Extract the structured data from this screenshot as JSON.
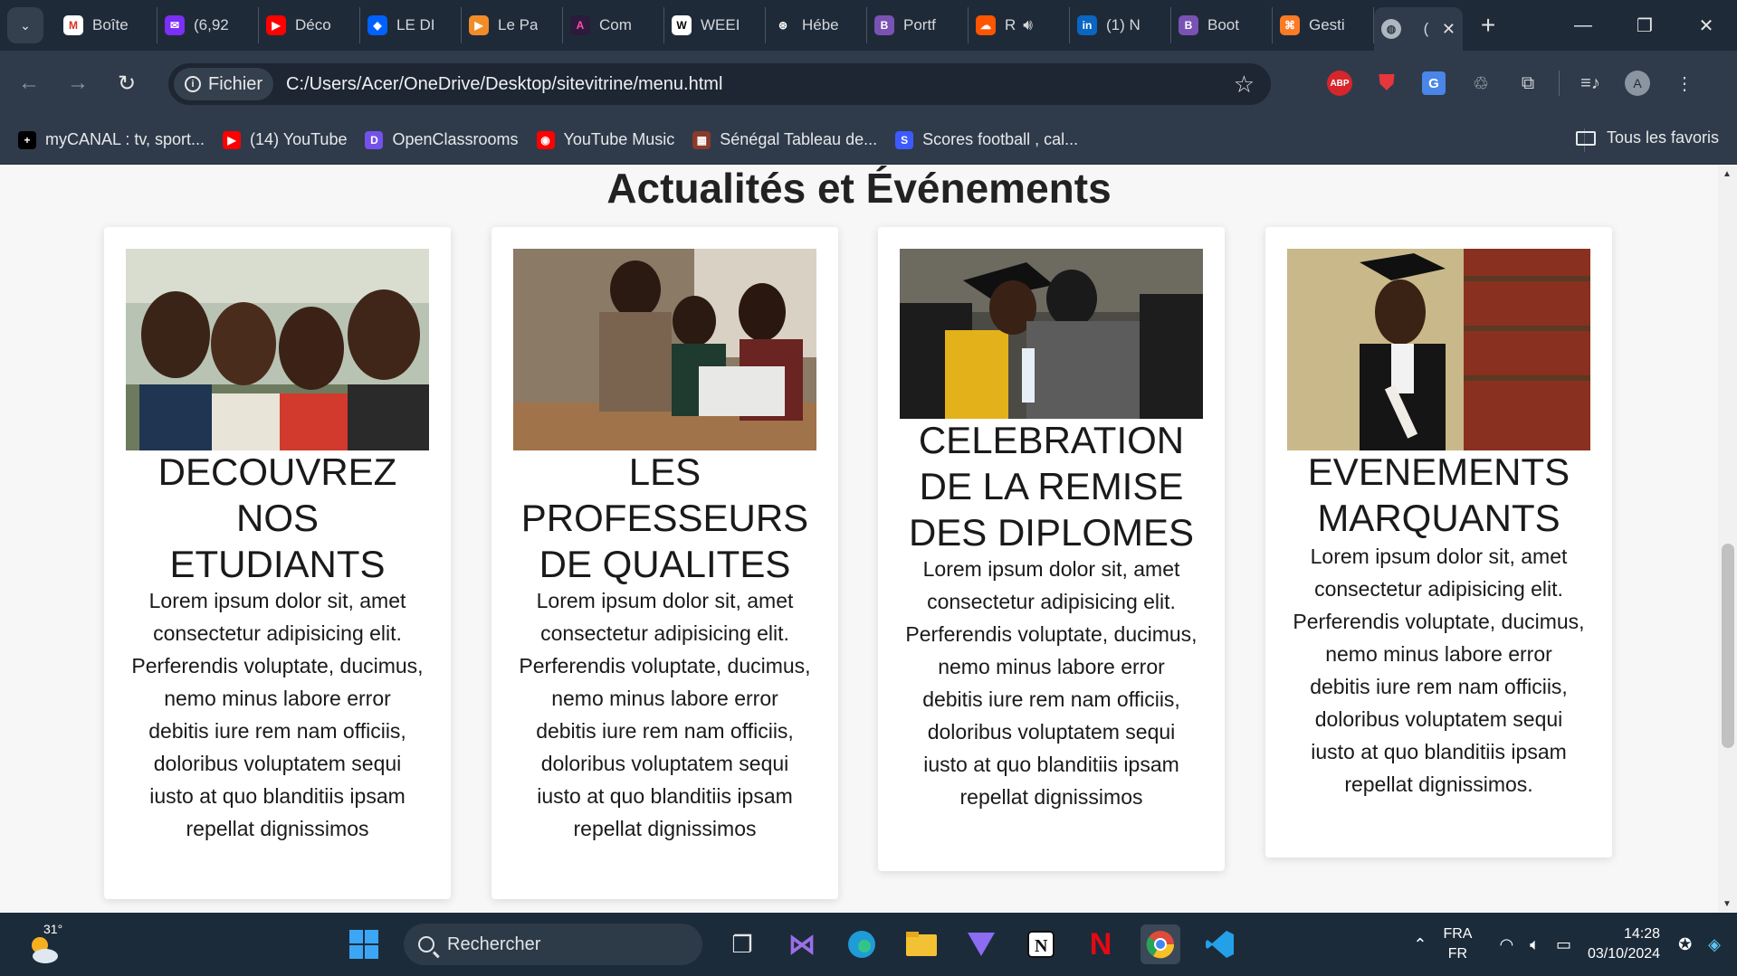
{
  "tabs": [
    {
      "label": "Boîte",
      "fav_color": "#ffffff",
      "fav_text": "M",
      "fav_text_color": "#d93025"
    },
    {
      "label": "(6,92",
      "fav_color": "#7b2ff7",
      "fav_text": "✉",
      "fav_text_color": "#ffffff"
    },
    {
      "label": "Déco",
      "fav_color": "#ff0000",
      "fav_text": "▶",
      "fav_text_color": "#ffffff"
    },
    {
      "label": "LE DI",
      "fav_color": "#0061fe",
      "fav_text": "◆",
      "fav_text_color": "#ffffff"
    },
    {
      "label": "Le Pa",
      "fav_color": "#f28c28",
      "fav_text": "▶",
      "fav_text_color": "#ffffff"
    },
    {
      "label": "Com",
      "fav_color": "#2b1b3d",
      "fav_text": "A",
      "fav_text_color": "#ff4fa3"
    },
    {
      "label": "WEEI",
      "fav_color": "#ffffff",
      "fav_text": "W",
      "fav_text_color": "#000000"
    },
    {
      "label": "Hébe",
      "fav_color": "#1f2a38",
      "fav_text": "⊛",
      "fav_text_color": "#ffffff"
    },
    {
      "label": "Portf",
      "fav_color": "#7952b3",
      "fav_text": "B",
      "fav_text_color": "#ffffff"
    },
    {
      "label": "R",
      "fav_color": "#ff5500",
      "fav_text": "☁",
      "fav_text_color": "#ffffff"
    },
    {
      "label": "(1) N",
      "fav_color": "#0a66c2",
      "fav_text": "in",
      "fav_text_color": "#ffffff"
    },
    {
      "label": "Boot",
      "fav_color": "#7952b3",
      "fav_text": "B",
      "fav_text_color": "#ffffff"
    },
    {
      "label": "Gesti",
      "fav_color": "#fb7a24",
      "fav_text": "⌘",
      "fav_text_color": "#ffffff"
    }
  ],
  "active_tab": {
    "label": "("
  },
  "address": {
    "chip": "Fichier",
    "url": "C:/Users/Acer/OneDrive/Desktop/sitevitrine/menu.html",
    "avatar": "A",
    "abp": "ABP",
    "translate": "G"
  },
  "bookmarks": [
    {
      "label": "myCANAL : tv, sport...",
      "icon_color": "#000000",
      "icon_text": "+"
    },
    {
      "label": "(14) YouTube",
      "icon_color": "#ff0000",
      "icon_text": "▶"
    },
    {
      "label": "OpenClassrooms",
      "icon_color": "#7451eb",
      "icon_text": "D"
    },
    {
      "label": "YouTube Music",
      "icon_color": "#ff0000",
      "icon_text": "◉"
    },
    {
      "label": "Sénégal Tableau de...",
      "icon_color": "#8a3b2b",
      "icon_text": "▦"
    },
    {
      "label": "Scores football , cal...",
      "icon_color": "#3d5afe",
      "icon_text": "S"
    }
  ],
  "all_bookmarks": "Tous les favoris",
  "page": {
    "heading": "Actualités et Événements",
    "cards": [
      {
        "title_lines": [
          "DECOUVREZ",
          "NOS",
          "ETUDIANTS"
        ],
        "text": "Lorem ipsum dolor sit, amet consectetur adipisicing elit. Perferendis voluptate, ducimus, nemo minus labore error debitis iure rem nam officiis, doloribus voluptatem sequi iusto at quo blanditiis ipsam repellat dignissimos"
      },
      {
        "title_lines": [
          "LES",
          "PROFESSEURS",
          "DE QUALITES"
        ],
        "text": "Lorem ipsum dolor sit, amet consectetur adipisicing elit. Perferendis voluptate, ducimus, nemo minus labore error debitis iure rem nam officiis, doloribus voluptatem sequi iusto at quo blanditiis ipsam repellat dignissimos"
      },
      {
        "title_lines": [
          "CELEBRATION",
          "DE LA REMISE",
          "DES DIPLOMES"
        ],
        "text": "Lorem ipsum dolor sit, amet consectetur adipisicing elit. Perferendis voluptate, ducimus, nemo minus labore error debitis iure rem nam officiis, doloribus voluptatem sequi iusto at quo blanditiis ipsam repellat dignissimos"
      },
      {
        "title_lines": [
          "EVENEMENTS",
          "MARQUANTS"
        ],
        "text": "Lorem ipsum dolor sit, amet consectetur adipisicing elit. Perferendis voluptate, ducimus, nemo minus labore error debitis iure rem nam officiis, doloribus voluptatem sequi iusto at quo blanditiis ipsam repellat dignissimos."
      }
    ]
  },
  "taskbar": {
    "temperature": "31°",
    "search_placeholder": "Rechercher",
    "lang_top": "FRA",
    "lang_bottom": "FR",
    "time": "14:28",
    "date": "03/10/2024"
  }
}
